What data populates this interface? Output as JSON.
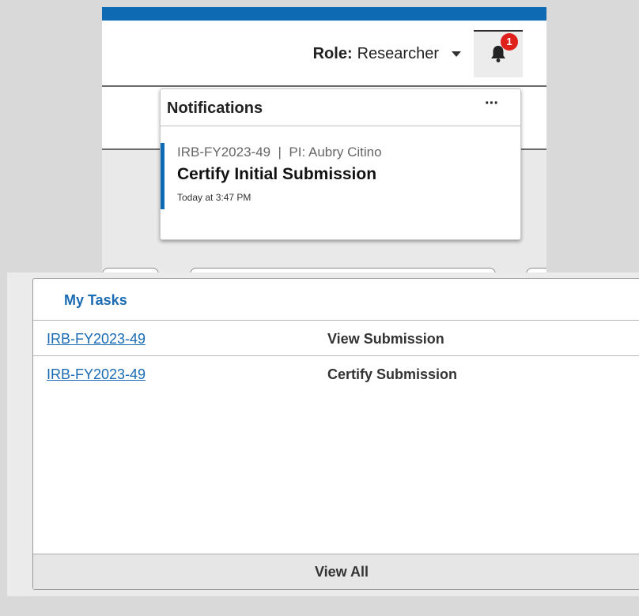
{
  "header": {
    "role_label": "Role:",
    "role_value": "Researcher",
    "notification_count": "1",
    "accent_color": "#0e6bb3"
  },
  "notifications": {
    "title": "Notifications",
    "more_label": "···",
    "items": [
      {
        "meta": "IRB-FY2023-49  |  PI: Aubry Citino",
        "title": "Certify Initial Submission",
        "time": "Today at 3:47 PM"
      }
    ]
  },
  "tasks": {
    "title": "My Tasks",
    "rows": [
      {
        "id": "IRB-FY2023-49",
        "action": "View Submission"
      },
      {
        "id": "IRB-FY2023-49",
        "action": "Certify Submission"
      }
    ],
    "view_all_label": "View All"
  },
  "icons": {
    "bell": "bell-icon",
    "caret": "caret-down-icon",
    "more": "more-horizontal-icon"
  }
}
